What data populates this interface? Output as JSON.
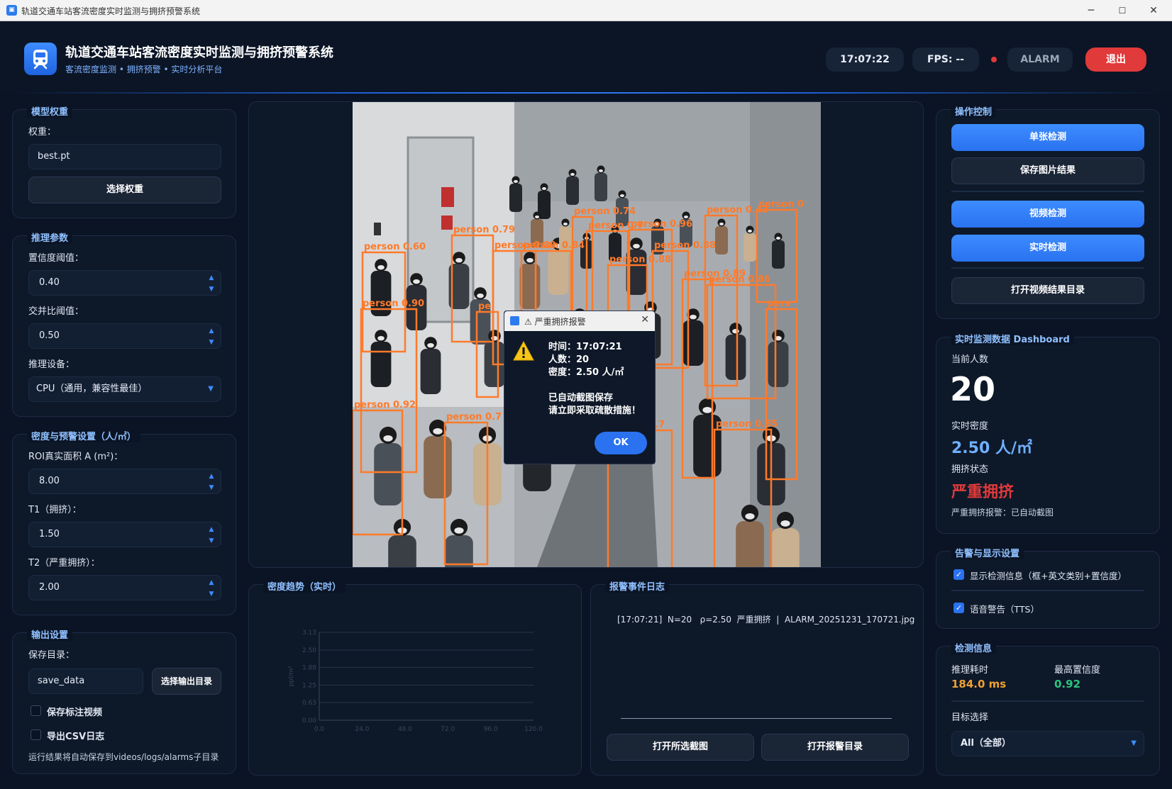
{
  "window": {
    "title": "轨道交通车站客流密度实时监测与拥挤预警系统",
    "min": "─",
    "max": "☐",
    "close": "✕"
  },
  "header": {
    "title": "轨道交通车站客流密度实时监测与拥挤预警系统",
    "subtitle": "客流密度监测 • 拥挤预警 • 实时分析平台",
    "time": "17:07:22",
    "fps": "FPS: --",
    "alarm": "ALARM",
    "exit": "退出"
  },
  "model": {
    "title": "模型权重",
    "weight_label": "权重：",
    "weight_value": "best.pt",
    "select_btn": "选择权重"
  },
  "infer": {
    "title": "推理参数",
    "conf_label": "置信度阈值：",
    "conf_value": "0.40",
    "iou_label": "交并比阈值：",
    "iou_value": "0.50",
    "device_label": "推理设备：",
    "device_value": "CPU（通用，兼容性最佳）"
  },
  "density": {
    "title": "密度与预警设置（人/㎡）",
    "roi_label": "ROI真实面积 A (m²)：",
    "roi_value": "8.00",
    "t1_label": "T1（拥挤）：",
    "t1_value": "1.50",
    "t2_label": "T2（严重拥挤）：",
    "t2_value": "2.00"
  },
  "output": {
    "title": "输出设置",
    "dir_label": "保存目录：",
    "dir_value": "save_data",
    "dir_btn": "选择输出目录",
    "save_video": "保存标注视频",
    "export_csv": "导出CSV日志",
    "note": "运行结果将自动保存到videos/logs/alarms子目录"
  },
  "detections": [
    {
      "label": "person 0.60"
    },
    {
      "label": "person 0.79"
    },
    {
      "label": "person 0.89"
    },
    {
      "label": "person 0.84"
    },
    {
      "label": "person 0.74"
    },
    {
      "label": "person 0.7"
    },
    {
      "label": "person 0.96"
    },
    {
      "label": "person 0.43"
    },
    {
      "label": "person 0"
    },
    {
      "label": "person 0.86"
    },
    {
      "label": "person 0.88"
    },
    {
      "label": "person 0.90"
    },
    {
      "label": "person 0.89"
    },
    {
      "label": "person 0.7"
    },
    {
      "label": "person 0.88"
    },
    {
      "label": "person 0.92"
    },
    {
      "label": "person 0.7"
    },
    {
      "label": "person 0.85"
    },
    {
      "label": "pers"
    },
    {
      "label": "pe"
    }
  ],
  "dialog": {
    "title": "⚠ 严重拥挤报警",
    "time": "时间：17:07:21",
    "count": "人数：20",
    "density": "密度：2.50 人/㎡",
    "saved": "已自动截图保存",
    "action": "请立即采取疏散措施！",
    "ok": "OK"
  },
  "trend": {
    "title": "密度趋势（实时）"
  },
  "chart_data": {
    "type": "line",
    "title": "",
    "xlabel": "",
    "ylabel": "ppl/m²",
    "xlim": [
      0,
      120
    ],
    "ylim": [
      0,
      3.13
    ],
    "x_ticks": [
      "0.0",
      "24.0",
      "48.0",
      "72.0",
      "96.0",
      "120.0"
    ],
    "y_ticks": [
      "0.00",
      "0.63",
      "1.25",
      "1.88",
      "2.50",
      "3.13"
    ],
    "grid": true,
    "series": []
  },
  "log": {
    "title": "报警事件日志",
    "entry": "[17:07:21]  N=20   ρ=2.50  严重拥挤  |  ALARM_20251231_170721.jpg",
    "open_shot": "打开所选截图",
    "open_dir": "打开报警目录"
  },
  "ops": {
    "title": "操作控制",
    "single": "单张检测",
    "save_img": "保存图片结果",
    "video": "视频检测",
    "realtime": "实时检测",
    "open_video_dir": "打开视频结果目录"
  },
  "dashboard": {
    "title": "实时监测数据 Dashboard",
    "count_label": "当前人数",
    "count": "20",
    "density_label": "实时密度",
    "density": "2.50 人/㎡",
    "state_label": "拥挤状态",
    "state": "严重拥挤",
    "state_note": "严重拥挤报警：已自动截图"
  },
  "alert": {
    "title": "告警与显示设置",
    "show_info": "显示检测信息（框+英文类别+置信度）",
    "tts": "语音警告（TTS）"
  },
  "detinfo": {
    "title": "检测信息",
    "time_label": "推理耗时",
    "time": "184.0 ms",
    "conf_label": "最高置信度",
    "conf": "0.92",
    "target_label": "目标选择",
    "target": "All（全部）"
  },
  "colors": {
    "accent": "#2d7bf0",
    "danger": "#e03a3a",
    "warn": "#f0a030",
    "ok": "#2ec27e",
    "box": "#ff7a2a"
  }
}
